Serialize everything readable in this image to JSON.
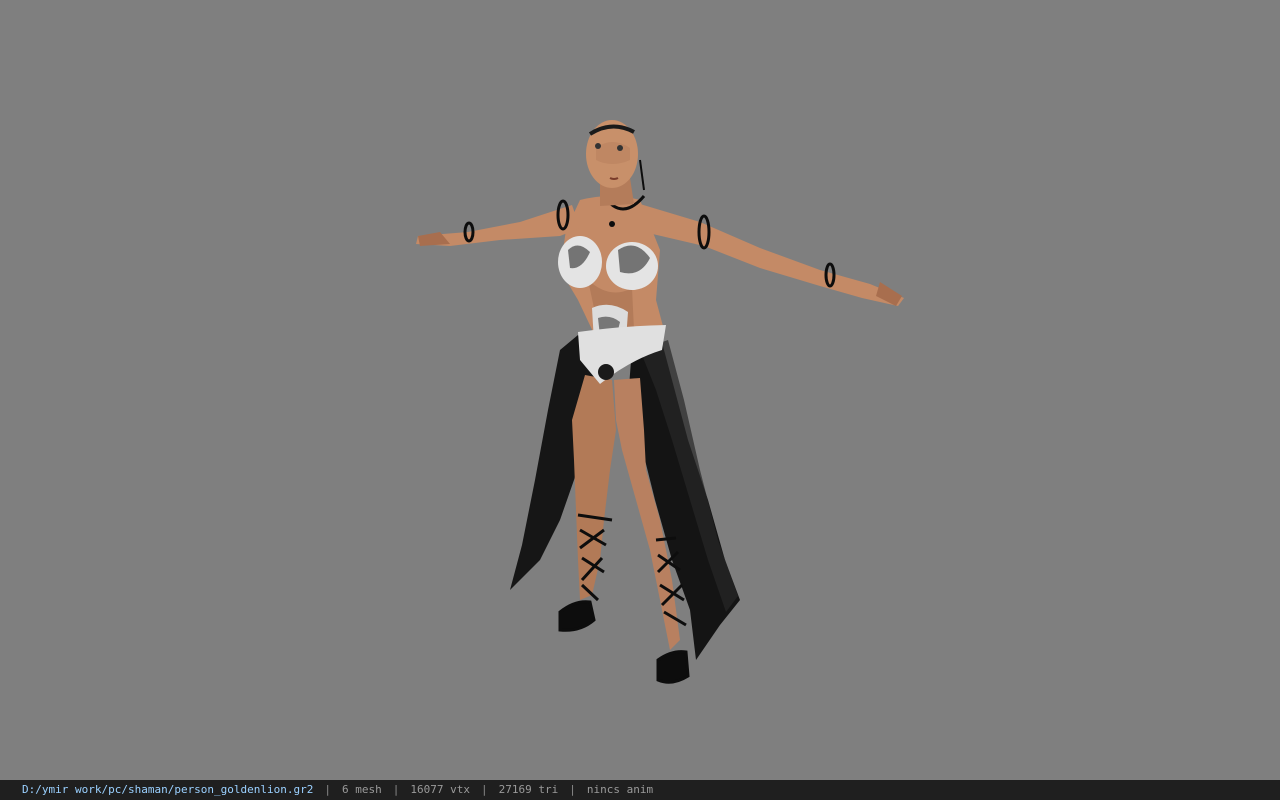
{
  "viewport": {
    "background_color": "#7f7f7f",
    "model": {
      "subject": "character-model",
      "colors": {
        "skin": "#c48a66",
        "skin_shadow": "#9a6446",
        "cloth": "#161616",
        "armor": "#e4e4e4",
        "accessory": "#0d0d0d"
      }
    }
  },
  "status_bar": {
    "file_path": "D:/ymir work/pc/shaman/person_goldenlion.gr2",
    "mesh": "6 mesh",
    "vertices": "16077 vtx",
    "triangles": "27169 tri",
    "animation": "nincs anim",
    "separator": "|",
    "colors": {
      "background": "#1f1f1f",
      "path": "#9ad0ff",
      "text": "#9a9a9a"
    }
  }
}
